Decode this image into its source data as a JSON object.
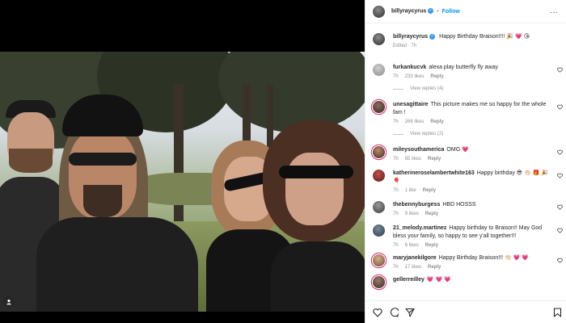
{
  "header": {
    "username": "billyraycyrus",
    "follow_label": "Follow",
    "separator": "•",
    "more_label": "..."
  },
  "caption": {
    "username": "billyraycyrus",
    "text": "Happy Birthday Braison!!!! 🎉 💗 😘",
    "meta": "Edited · 7h"
  },
  "comments": [
    {
      "username": "furkankucvk",
      "text": "alexa play butterfly fly away",
      "time": "7h",
      "likes": "233 likes",
      "reply": "Reply",
      "view_replies": "View replies (4)"
    },
    {
      "username": "unesagittaire",
      "text": "This picture makes me so happy for the whole fam !",
      "time": "7h",
      "likes": "266 likes",
      "reply": "Reply",
      "view_replies": "View replies (2)"
    },
    {
      "username": "mileysouthamerica",
      "text": "OMG 💗",
      "time": "7h",
      "likes": "65 likes",
      "reply": "Reply"
    },
    {
      "username": "katherineroselambertwhite163",
      "text": "Happy birthday 😎 👏🏻 🎁 🎉 🎈",
      "time": "7h",
      "likes": "1 like",
      "reply": "Reply"
    },
    {
      "username": "thebennyburgess",
      "text": "HBD HOSSS",
      "time": "7h",
      "likes": "9 likes",
      "reply": "Reply"
    },
    {
      "username": "21_melody.martinez",
      "text": "Happy birthday to Braison!! May God bless your family, so happy to see y'all together!!!",
      "time": "7h",
      "likes": "6 likes",
      "reply": "Reply"
    },
    {
      "username": "maryjanekilgore",
      "text": "Happy Birthday Braison!!! 👏🏻 💗 💗",
      "time": "7h",
      "likes": "17 likes",
      "reply": "Reply"
    },
    {
      "username": "gellerreilley",
      "text": "💗 💗 💗"
    }
  ],
  "icons": {
    "like": "heart-icon",
    "comment": "comment-icon",
    "share": "share-icon",
    "save": "bookmark-icon",
    "tag": "user-tag-icon"
  },
  "colors": {
    "accent": "#0095f6",
    "verified": "#3897f0",
    "muted": "#8e8e8e",
    "border": "#efefef"
  }
}
